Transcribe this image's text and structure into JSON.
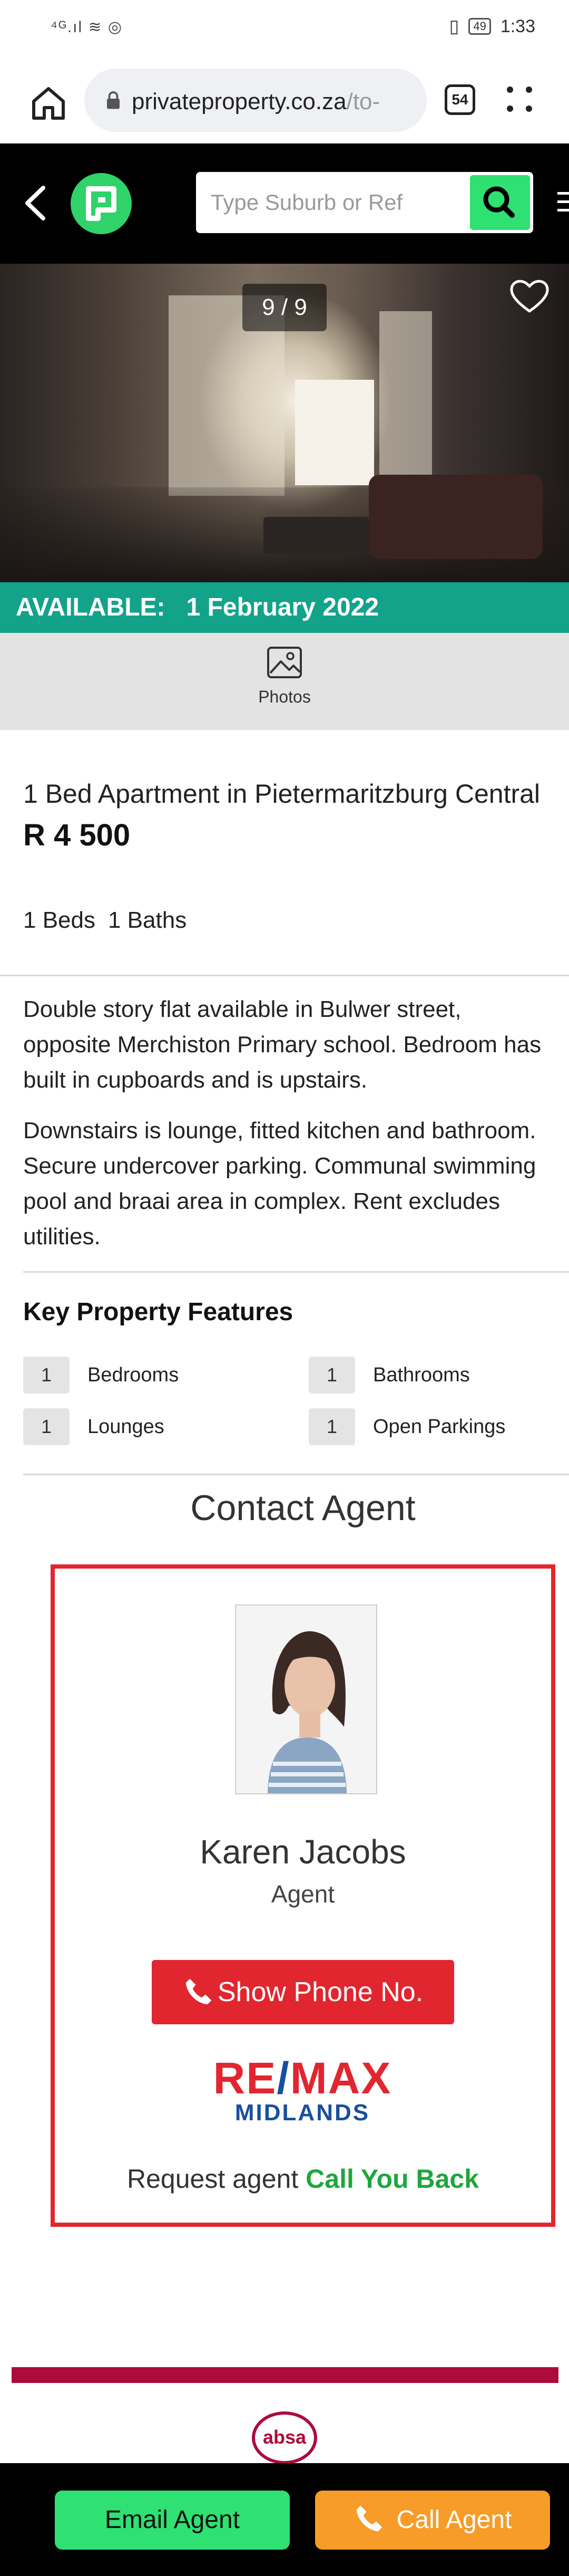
{
  "status_bar": {
    "signal": "⁴ᴳ.ıl ≋ ◎",
    "battery": "49",
    "time": "1:33"
  },
  "browser": {
    "url_main": "privateproperty.co.za",
    "url_path": "/to-",
    "tab_count": "54"
  },
  "header": {
    "search_placeholder": "Type Suburb or Ref"
  },
  "gallery": {
    "counter": "9 / 9"
  },
  "availability": {
    "label": "AVAILABLE:",
    "date": "1 February 2022"
  },
  "photos_label": "Photos",
  "listing": {
    "title": "1 Bed Apartment in Pietermaritzburg Central",
    "price": "R 4 500",
    "beds": "1 Beds",
    "baths": "1 Baths",
    "description": [
      "Double story flat available in Bulwer street, opposite Merchiston Primary school. Bedroom has built in cupboards and is upstairs.",
      "Downstairs is lounge, fitted kitchen and bathroom. Secure undercover parking. Communal swimming pool and braai area in complex. Rent excludes utilities."
    ]
  },
  "features": {
    "title": "Key Property Features",
    "items": [
      {
        "count": "1",
        "label": "Bedrooms"
      },
      {
        "count": "1",
        "label": "Bathrooms"
      },
      {
        "count": "1",
        "label": "Lounges"
      },
      {
        "count": "1",
        "label": "Open Parkings"
      }
    ]
  },
  "contact": {
    "title": "Contact Agent",
    "agent_name": "Karen Jacobs",
    "agent_role": "Agent",
    "phone_button": "Show Phone No.",
    "agency_logo_main": "RE/MAX",
    "agency_logo_sub": "MIDLANDS",
    "callback_prefix": "Request agent",
    "callback_link": "Call You Back"
  },
  "ad": {
    "logo": "absa"
  },
  "bottom": {
    "email": "Email Agent",
    "call": "Call Agent"
  },
  "colors": {
    "brand_green": "#2fe072",
    "teal": "#13a38a",
    "red": "#e1262f",
    "orange": "#f79c28",
    "absa": "#ad0b3c"
  }
}
